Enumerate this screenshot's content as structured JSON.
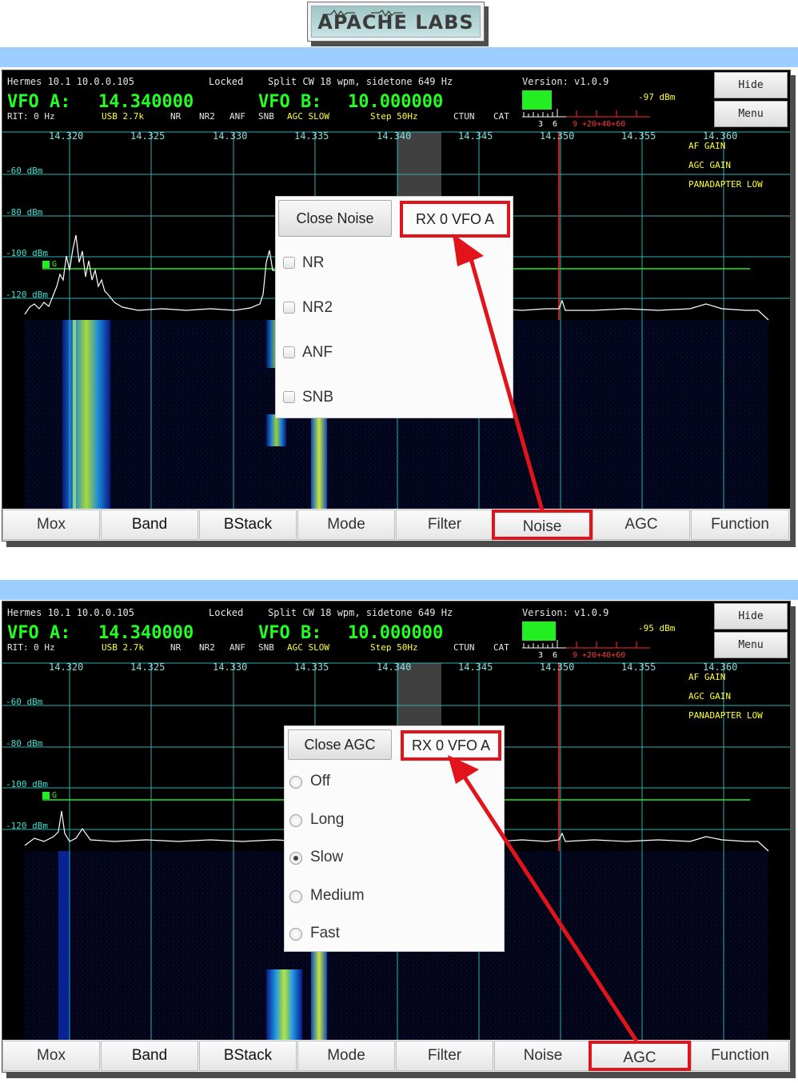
{
  "logo": {
    "text": "APACHE LABS"
  },
  "header": {
    "device": "Hermes 10.1 10.0.0.105",
    "lock": "Locked",
    "split": "Split CW 18 wpm, sidetone 649 Hz",
    "version": "Version: v1.0.9",
    "vfo_a_label": "VFO A:",
    "vfo_a_freq": "14.340000",
    "vfo_b_label": "VFO B:",
    "vfo_b_freq": "10.000000",
    "rit": "RIT: 0 Hz",
    "mode": "USB 2.7k",
    "nr": "NR",
    "nr2": "NR2",
    "anf": "ANF",
    "snb": "SNB",
    "agc": "AGC SLOW",
    "step": "Step 50Hz",
    "ctun": "CTUN",
    "cat": "CAT",
    "meter_scale_low": "3  6",
    "meter_scale_high": "9 +20+40+60"
  },
  "side": {
    "hide": "Hide",
    "menu": "Menu"
  },
  "freq_ticks": [
    "14.320",
    "14.325",
    "14.330",
    "14.335",
    "14.340",
    "14.345",
    "14.350",
    "14.355",
    "14.360"
  ],
  "dbm_labels": [
    "-60 dBm",
    "-80 dBm",
    "-100 dBm",
    "-120 dBm"
  ],
  "agc_marker": "G",
  "right_labels": [
    "AF GAIN",
    "AGC GAIN",
    "PANADAPTER LOW"
  ],
  "bottom_buttons": [
    "Mox",
    "Band",
    "BStack",
    "Mode",
    "Filter",
    "Noise",
    "AGC",
    "Function"
  ],
  "screen1": {
    "signal": "-97 dBm",
    "popup": {
      "close": "Close Noise",
      "title": "RX 0 VFO A",
      "options": [
        {
          "label": "NR",
          "checked": false
        },
        {
          "label": "NR2",
          "checked": false
        },
        {
          "label": "ANF",
          "checked": false
        },
        {
          "label": "SNB",
          "checked": false
        }
      ]
    },
    "highlighted_button": "Noise"
  },
  "screen2": {
    "signal": "-95 dBm",
    "popup": {
      "close": "Close AGC",
      "title": "RX 0 VFO A",
      "options": [
        {
          "label": "Off",
          "selected": false
        },
        {
          "label": "Long",
          "selected": false
        },
        {
          "label": "Slow",
          "selected": true
        },
        {
          "label": "Medium",
          "selected": false
        },
        {
          "label": "Fast",
          "selected": false
        }
      ]
    },
    "highlighted_button": "AGC"
  },
  "colors": {
    "accent_band": "#9ccfff",
    "vfo_green": "#22ff22",
    "callout_red": "#e1141b",
    "grid_cyan": "#40e0d0",
    "label_yellow": "#ffff33"
  }
}
